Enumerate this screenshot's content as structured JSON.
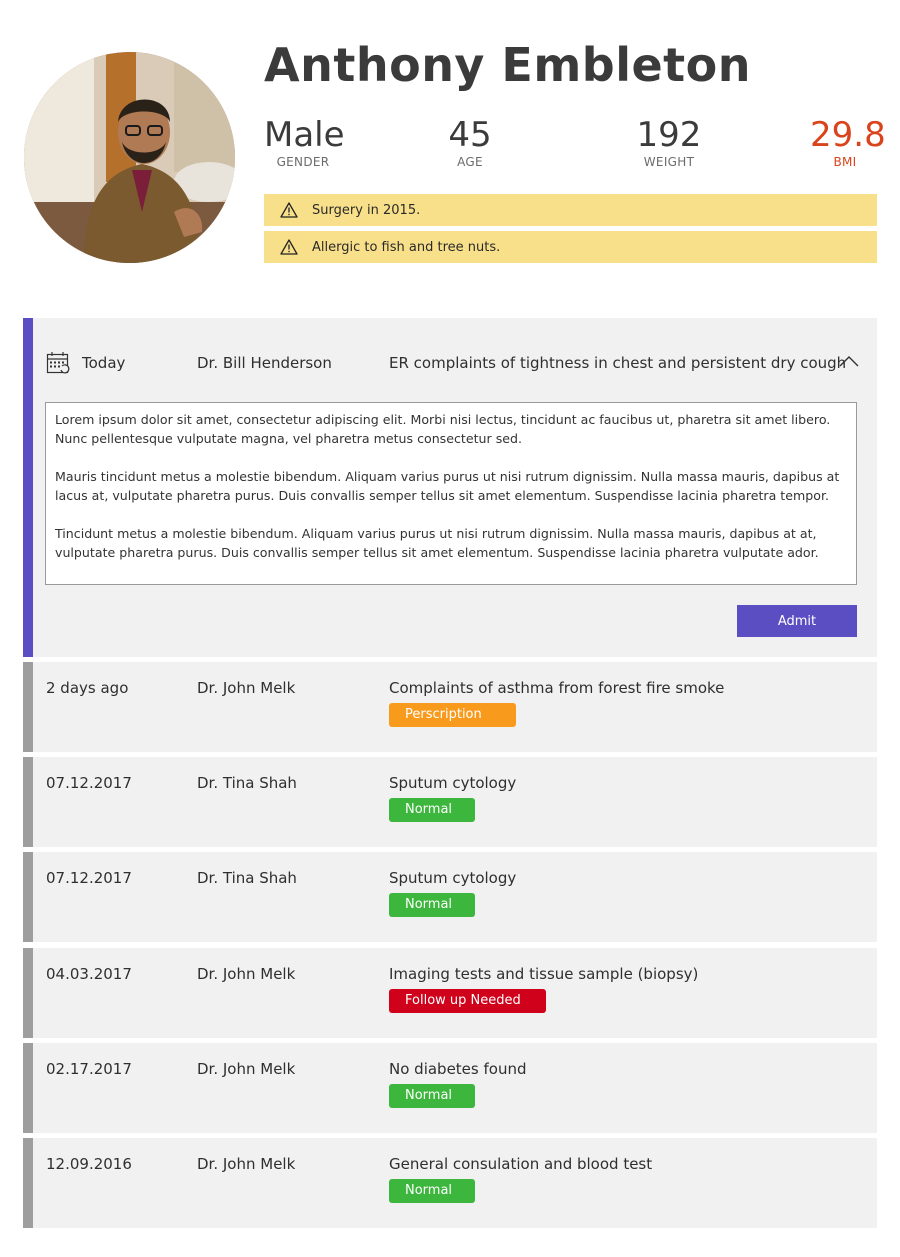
{
  "patient": {
    "name": "Anthony Embleton",
    "stats": [
      {
        "value": "Male",
        "label": "GENDER"
      },
      {
        "value": "45",
        "label": "AGE"
      },
      {
        "value": "192",
        "label": "WEIGHT"
      },
      {
        "value": "29.8",
        "label": "BMI"
      }
    ],
    "alerts": [
      {
        "icon": "warning-icon",
        "text": "Surgery in 2015."
      },
      {
        "icon": "warning-icon",
        "text": "Allergic to fish and tree nuts."
      }
    ]
  },
  "expanded_visit": {
    "date": "Today",
    "doctor": "Dr. Bill Henderson",
    "summary": "ER complaints of tightness in chest and persistent dry cough",
    "notes": [
      "Lorem ipsum dolor sit amet, consectetur adipiscing elit. Morbi nisi lectus, tincidunt ac faucibus ut, pharetra sit amet libero. Nunc pellentesque vulputate magna, vel pharetra metus consectetur sed.",
      "Mauris tincidunt metus a molestie bibendum. Aliquam varius purus ut nisi rutrum dignissim. Nulla massa mauris, dapibus at lacus at, vulputate pharetra purus. Duis convallis semper tellus sit amet elementum. Suspendisse lacinia pharetra tempor.",
      "Tincidunt metus a molestie bibendum. Aliquam varius purus ut nisi rutrum dignissim. Nulla massa mauris, dapibus at  at, vulputate pharetra purus. Duis convallis semper tellus sit amet elementum. Suspendisse lacinia pharetra vulputate ador."
    ],
    "admit_label": "Admit"
  },
  "records": [
    {
      "date": "2 days ago",
      "doctor": "Dr. John Melk",
      "summary": "Complaints of asthma from forest fire smoke",
      "badge": "Perscription",
      "badge_color": "#f89b1c"
    },
    {
      "date": "07.12.2017",
      "doctor": "Dr. Tina Shah",
      "summary": "Sputum cytology",
      "badge": "Normal",
      "badge_color": "#3cb63c"
    },
    {
      "date": "07.12.2017",
      "doctor": "Dr. Tina Shah",
      "summary": "Sputum cytology",
      "badge": "Normal",
      "badge_color": "#3cb63c"
    },
    {
      "date": "04.03.2017",
      "doctor": "Dr. John Melk",
      "summary": "Imaging tests and tissue sample (biopsy)",
      "badge": "Follow up Needed",
      "badge_color": "#d0021b"
    },
    {
      "date": "02.17.2017",
      "doctor": "Dr. John Melk",
      "summary": "No diabetes found",
      "badge": "Normal",
      "badge_color": "#3cb63c"
    },
    {
      "date": "12.09.2016",
      "doctor": "Dr. John Melk",
      "summary": "General consulation and blood test",
      "badge": "Normal",
      "badge_color": "#3cb63c"
    }
  ],
  "colors": {
    "accent": "#5b4ec2",
    "bmi": "#d9441c",
    "alert_bg": "#f8e08a",
    "card_bg": "#f1f1f1"
  }
}
